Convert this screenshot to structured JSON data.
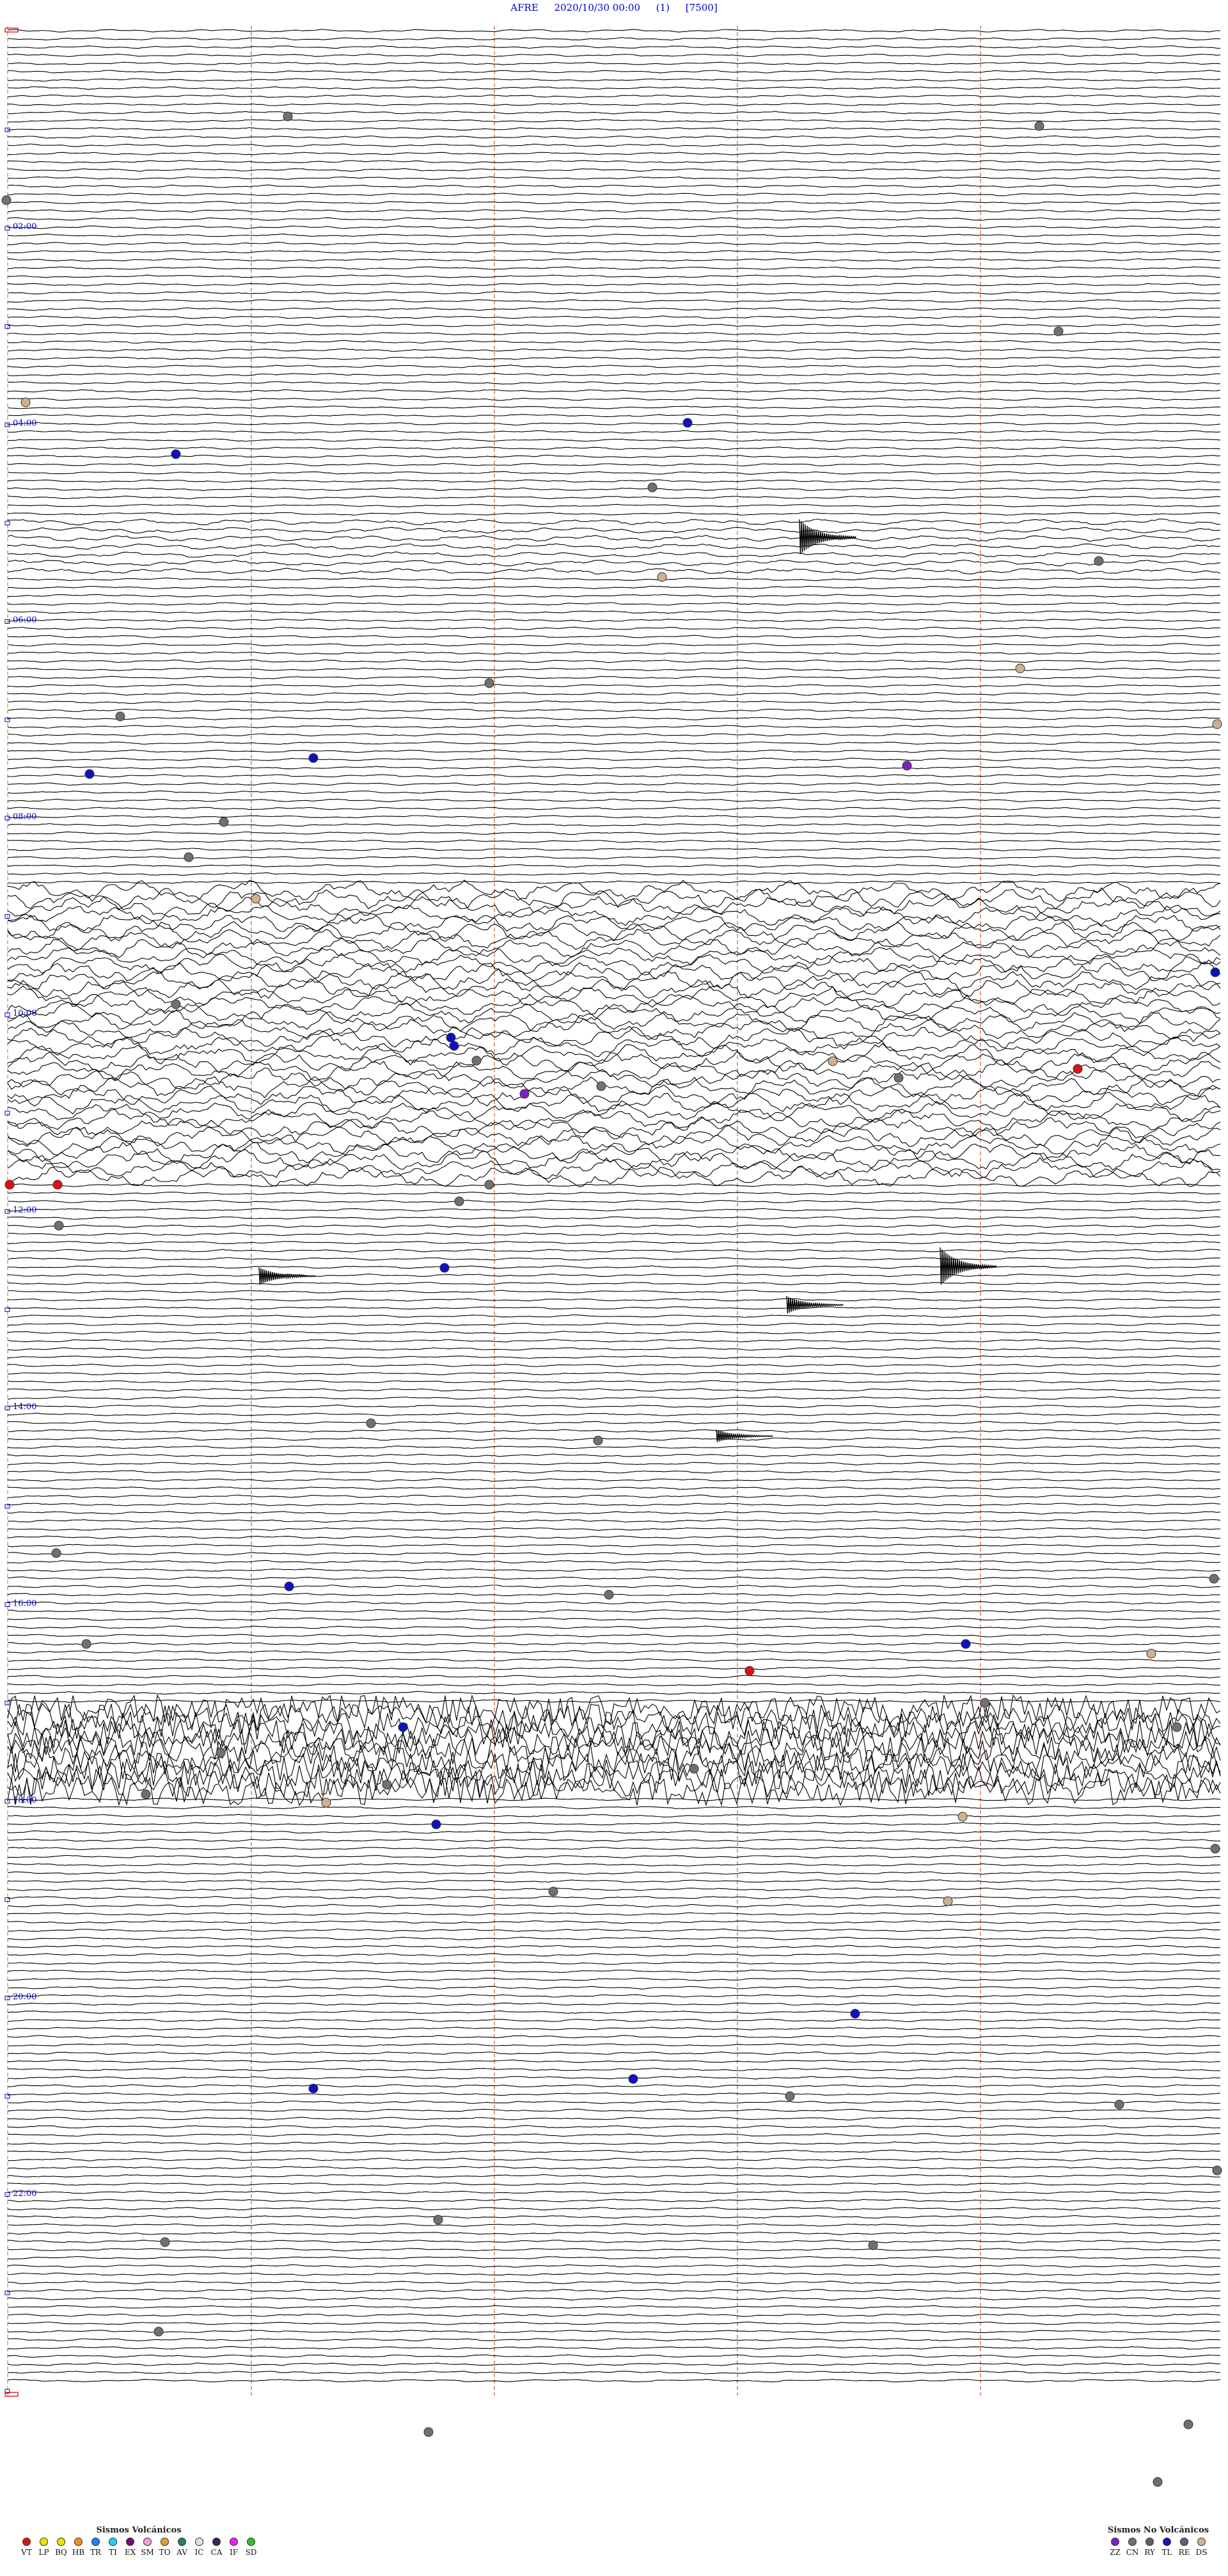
{
  "header": {
    "station": "AFRE",
    "datetime": "2020/10/30 00:00",
    "channel": "(1)",
    "scale": "[7500]"
  },
  "hour_labels": [
    "02:00",
    "04:00",
    "06:00",
    "08:00",
    "10:00",
    "12:00",
    "14:00",
    "16:00",
    "18:00",
    "20:00",
    "22:00"
  ],
  "legend": {
    "volcanic_title": "Sismos Volcánicos",
    "volcanic": [
      {
        "code": "VT",
        "color": "#e01010"
      },
      {
        "code": "LP",
        "color": "#f0e000"
      },
      {
        "code": "BQ",
        "color": "#f0e000"
      },
      {
        "code": "HB",
        "color": "#f09020"
      },
      {
        "code": "TR",
        "color": "#2080f0"
      },
      {
        "code": "TI",
        "color": "#20d0f0"
      },
      {
        "code": "EX",
        "color": "#701070"
      },
      {
        "code": "SM",
        "color": "#f0a0d0"
      },
      {
        "code": "TO",
        "color": "#e0a030"
      },
      {
        "code": "AV",
        "color": "#208060"
      },
      {
        "code": "IC",
        "color": "#e0e0e0"
      },
      {
        "code": "CA",
        "color": "#402060"
      },
      {
        "code": "IF",
        "color": "#f020f0"
      },
      {
        "code": "SD",
        "color": "#30c030"
      }
    ],
    "nonvolcanic_title": "Sismos No Volcánicos",
    "nonvolcanic": [
      {
        "code": "ZZ",
        "color": "#8020c0"
      },
      {
        "code": "CN",
        "color": "#707070"
      },
      {
        "code": "RY",
        "color": "#606060"
      },
      {
        "code": "TL",
        "color": "#1010c0"
      },
      {
        "code": "RE",
        "color": "#606070"
      },
      {
        "code": "DS",
        "color": "#d0b090"
      }
    ]
  },
  "colors": {
    "trace": "#000000",
    "grid": "#d08060",
    "label": "#0000cc"
  }
}
